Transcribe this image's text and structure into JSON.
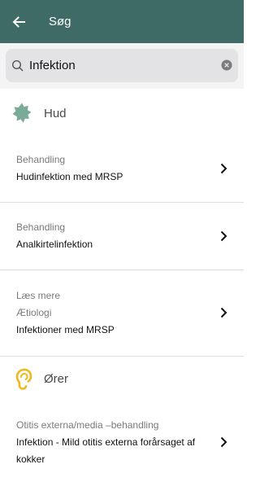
{
  "appbar": {
    "title": "Søg",
    "background": "#3f6b66"
  },
  "search": {
    "value": "Infektion",
    "placeholder": ""
  },
  "sections": [
    {
      "title": "Hud",
      "icon": "skin-patch-icon",
      "icon_color": "#7aab98",
      "items": [
        {
          "meta": [
            "Behandling"
          ],
          "title": "Hudinfektion med MRSP"
        },
        {
          "meta": [
            "Behandling"
          ],
          "title": "Analkirtelinfektion"
        },
        {
          "meta": [
            "Læs mere",
            "Ætiologi"
          ],
          "title": "Infektioner med MRSP"
        }
      ]
    },
    {
      "title": "Ører",
      "icon": "ear-icon",
      "icon_color": "#f0b81c",
      "items": [
        {
          "meta": [
            "Otitis externa/media –behandling"
          ],
          "title_lines": [
            "Infektion - Mild otitis externa forårsaget af",
            "kokker"
          ]
        }
      ]
    }
  ]
}
